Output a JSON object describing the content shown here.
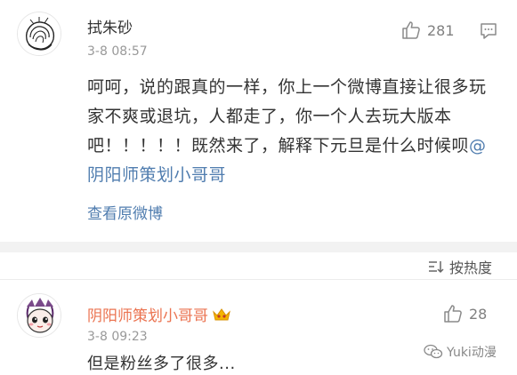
{
  "comment": {
    "username": "拭朱砂",
    "timestamp": "3-8 08:57",
    "likes": "281",
    "text_before_mention": "呵呵，说的跟真的一样，你上一个微博直接让很多玩家不爽或退坑，人都走了，你一个人去玩大版本吧！！！！！既然来了，解释下元旦是什么时候呗",
    "mention": "@阴阳师策划小哥哥",
    "view_original": "查看原微博"
  },
  "sort": {
    "label": "按热度"
  },
  "reply": {
    "username": "阴阳师策划小哥哥",
    "timestamp": "3-8 09:23",
    "likes": "28",
    "text": "但是粉丝多了很多..."
  },
  "watermark": {
    "label": "Yuki动漫"
  },
  "colors": {
    "link_blue": "#507daf",
    "vip_orange": "#eb7350",
    "muted_gray": "#999999",
    "badge_gold": "#f5b400"
  },
  "icons": {
    "like": "thumbs-up-icon",
    "reply": "comment-bubble-icon",
    "sort": "sort-filter-icon",
    "badge": "vip-crown-badge-icon",
    "watermark": "wechat-logo-icon"
  }
}
